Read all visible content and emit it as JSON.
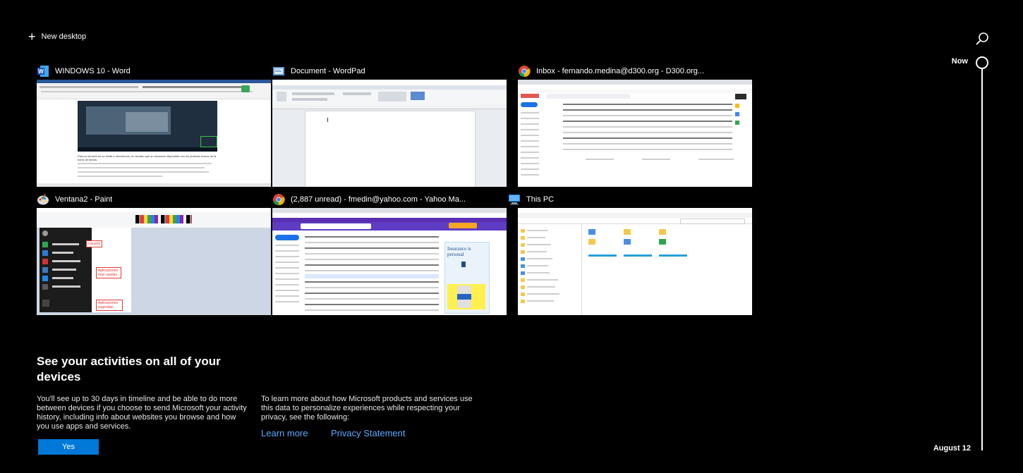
{
  "new_desktop": {
    "icon": "plus-icon",
    "label": "New desktop"
  },
  "search": {
    "icon": "search-icon"
  },
  "timeline": {
    "now_label": "Now",
    "date_label": "August 12"
  },
  "windows": [
    {
      "app_icon": "word-icon",
      "title": "WINDOWS 10 - Word",
      "thumb_text": "Para su función en su limite a otrorresnos, en teclado que su tomamos disponible con los pruebas iconos de la barra de tareas."
    },
    {
      "app_icon": "wordpad-icon",
      "title": "Document - WordPad"
    },
    {
      "app_icon": "chrome-icon",
      "title": "Inbox - fernando.medina@d300.org - D300.org..."
    },
    {
      "app_icon": "paint-icon",
      "title": "Ventana2 - Paint",
      "thumb_labels": [
        "Usuario",
        "Aplicaciones más usadas",
        "Aplicaciones sugeridas"
      ]
    },
    {
      "app_icon": "chrome-icon",
      "title": "(2,887 unread) - fmedin@yahoo.com - Yahoo Ma...",
      "thumb_ad": "Insurance is personal"
    },
    {
      "app_icon": "this-pc-icon",
      "title": "This PC"
    }
  ],
  "info": {
    "title": "See your activities on all of your devices",
    "description": "You'll see up to 30 days in timeline and be able to do more between devices if you choose to send Microsoft your activity history, including info about websites you browse and how you use apps and services.",
    "more": "To learn more about how Microsoft products and services use this data to personalize experiences while respecting your privacy, see the following:",
    "yes_label": "Yes",
    "learn_more_label": "Learn more",
    "privacy_label": "Privacy Statement"
  },
  "colors": {
    "background": "#000000",
    "accent": "#0078d7",
    "link": "#5aa9ff"
  }
}
